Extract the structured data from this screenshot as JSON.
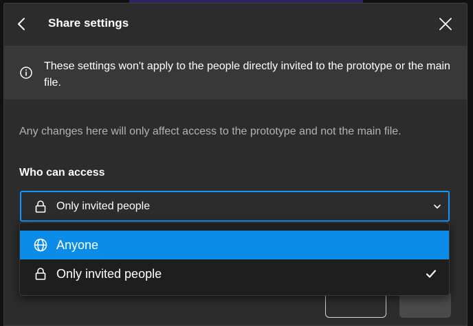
{
  "dialog": {
    "title": "Share settings",
    "notice": "These settings won't apply to the people directly invited to the prototype or the main file.",
    "description": "Any changes here will only affect access to the prototype and not the main file.",
    "access_label": "Who can access"
  },
  "select": {
    "value": "Only invited people"
  },
  "dropdown": {
    "options": [
      {
        "label": "Anyone",
        "icon": "globe-icon",
        "highlighted": true
      },
      {
        "label": "Only invited people",
        "icon": "lock-icon",
        "checked": true
      }
    ]
  },
  "colors": {
    "accent": "#0d99ff",
    "highlight": "#0c8ce9",
    "dialog_bg": "#2c2c2c",
    "notice_bg": "#383838",
    "dropdown_bg": "#1e1e1e"
  }
}
